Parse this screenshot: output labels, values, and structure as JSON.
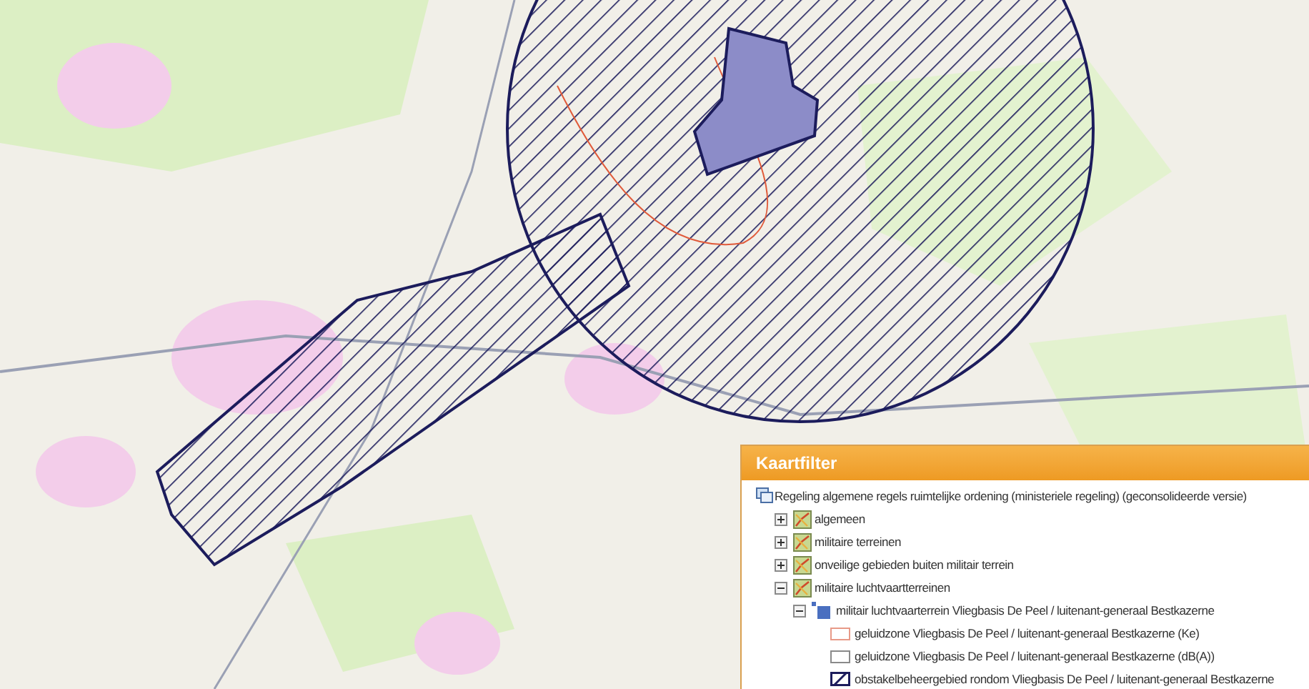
{
  "panel": {
    "title": "Kaartfilter",
    "tree": [
      {
        "kind": "root",
        "label": "Regeling algemene regels ruimtelijke ordening (ministeriele regeling) (geconsolideerde versie)",
        "children": [
          {
            "kind": "layer",
            "label": "algemeen",
            "expanded": false
          },
          {
            "kind": "layer",
            "label": "militaire terreinen",
            "expanded": false
          },
          {
            "kind": "layer",
            "label": "onveilige gebieden buiten militair terrein",
            "expanded": false
          },
          {
            "kind": "layer",
            "label": "militaire luchtvaartterreinen",
            "expanded": true,
            "children": [
              {
                "kind": "sublayer",
                "label": "militair luchtvaarterrein Vliegbasis De Peel / luitenant-generaal Bestkazerne",
                "expanded": true,
                "children": [
                  {
                    "kind": "outline",
                    "label": "geluidzone Vliegbasis De Peel / luitenant-generaal Bestkazerne (Ke)",
                    "color": "#e89a88"
                  },
                  {
                    "kind": "outline",
                    "label": "geluidzone Vliegbasis De Peel / luitenant-generaal Bestkazerne (dB(A))",
                    "color": "#8a8a8a"
                  },
                  {
                    "kind": "hatched",
                    "label": "obstakelbeheergebied rondom Vliegbasis De Peel / luitenant-generaal Bestkazerne",
                    "color": "#1c1c5c"
                  }
                ]
              }
            ]
          }
        ]
      }
    ]
  }
}
